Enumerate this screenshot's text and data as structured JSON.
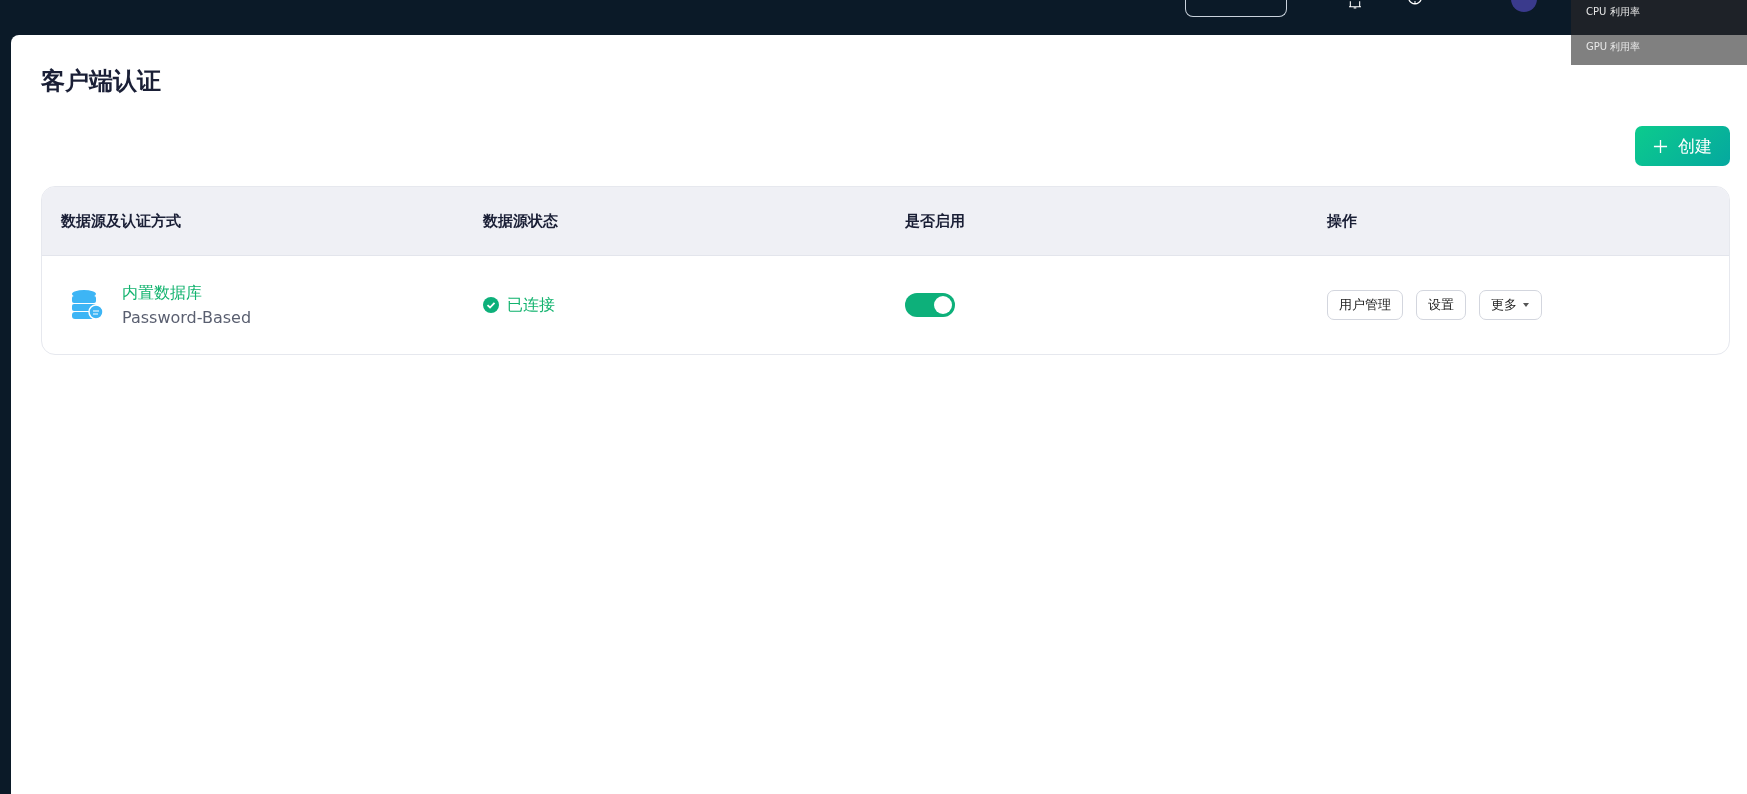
{
  "page": {
    "title": "客户端认证"
  },
  "create_button": {
    "label": "创建"
  },
  "table": {
    "columns": [
      "数据源及认证方式",
      "数据源状态",
      "是否启用",
      "操作"
    ],
    "rows": [
      {
        "name": "内置数据库",
        "method": "Password-Based",
        "status": "已连接",
        "enabled": true,
        "actions": [
          {
            "label": "用户管理",
            "kind": "plain"
          },
          {
            "label": "设置",
            "kind": "plain"
          },
          {
            "label": "更多",
            "kind": "dropdown"
          }
        ]
      }
    ]
  },
  "monitor_overlay": {
    "items": [
      "CPU 利用率",
      "GPU 利用率"
    ]
  }
}
